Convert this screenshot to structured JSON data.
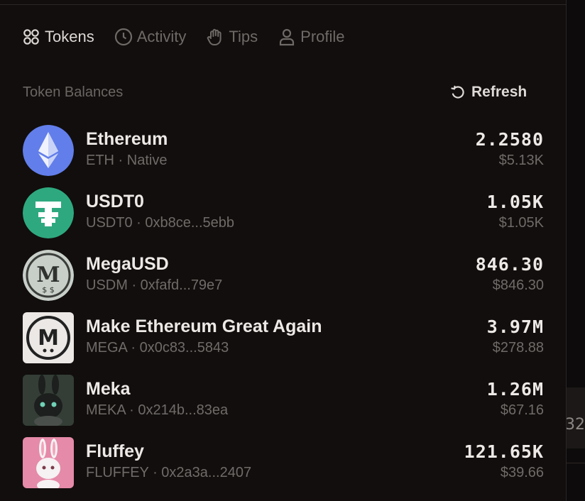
{
  "tabs": [
    {
      "label": "Tokens",
      "icon": "grid-icon",
      "active": true
    },
    {
      "label": "Activity",
      "icon": "clock-icon",
      "active": false
    },
    {
      "label": "Tips",
      "icon": "hand-icon",
      "active": false
    },
    {
      "label": "Profile",
      "icon": "user-icon",
      "active": false
    }
  ],
  "section_title": "Token Balances",
  "refresh_label": "Refresh",
  "tokens": [
    {
      "name": "Ethereum",
      "sub": "ETH · Native",
      "amount": "2.2580",
      "usd": "$5.13K",
      "color": "#627eea"
    },
    {
      "name": "USDT0",
      "sub": "USDT0 · 0xb8ce...5ebb",
      "amount": "1.05K",
      "usd": "$1.05K",
      "color": "#2ea97f"
    },
    {
      "name": "MegaUSD",
      "sub": "USDM · 0xfafd...79e7",
      "amount": "846.30",
      "usd": "$846.30",
      "color": "#c8cfc9"
    },
    {
      "name": "Make Ethereum Great Again",
      "sub": "MEGA · 0x0c83...5843",
      "amount": "3.97M",
      "usd": "$278.88",
      "color": "#ece8e6"
    },
    {
      "name": "Meka",
      "sub": "MEKA · 0x214b...83ea",
      "amount": "1.26M",
      "usd": "$67.16",
      "color": "#2f3a33"
    },
    {
      "name": "Fluffey",
      "sub": "FLUFFEY · 0x2a3a...2407",
      "amount": "121.65K",
      "usd": "$39.66",
      "color": "#e58aa8"
    }
  ],
  "side_fragment": "32"
}
